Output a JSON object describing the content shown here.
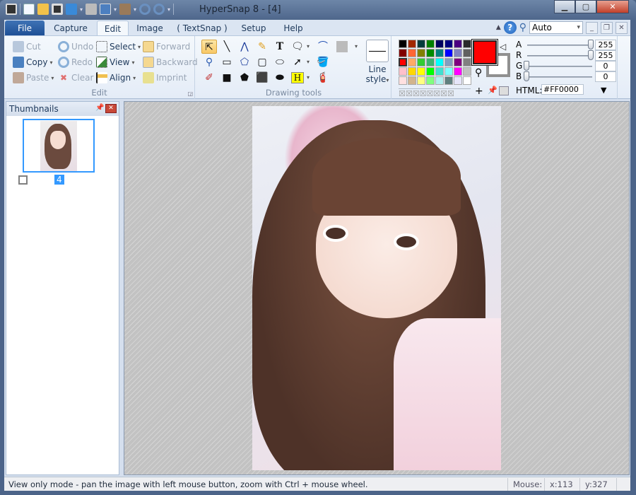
{
  "window": {
    "title": "HyperSnap 8 - [4]",
    "controls": [
      "minimize",
      "maximize",
      "close"
    ]
  },
  "quick_access": [
    "camera-icon",
    "new-icon",
    "open-icon",
    "save-icon",
    "upload-icon",
    "print-icon",
    "windows-icon",
    "clipboard-icon",
    "undo-icon",
    "redo-icon"
  ],
  "tabs": [
    {
      "label": "File"
    },
    {
      "label": "Capture"
    },
    {
      "label": "Edit",
      "active": true
    },
    {
      "label": "Image"
    },
    {
      "label": "( TextSnap )"
    },
    {
      "label": "Setup"
    },
    {
      "label": "Help"
    }
  ],
  "zoom": {
    "value": "Auto"
  },
  "edit_group": {
    "label": "Edit",
    "cut": "Cut",
    "copy": "Copy",
    "paste": "Paste",
    "undo": "Undo",
    "redo": "Redo",
    "clear": "Clear",
    "select": "Select",
    "view": "View",
    "align": "Align",
    "forward": "Forward",
    "backward": "Backward",
    "imprint": "Imprint"
  },
  "drawing_group": {
    "label": "Drawing tools",
    "line_style_1": "Line",
    "line_style_2": "style",
    "text_glyph": "T",
    "highlight_glyph": "H"
  },
  "palette": {
    "colors": [
      [
        "#000000",
        "#a02800",
        "#003c3c",
        "#008000",
        "#000060",
        "#000080",
        "#4b0082",
        "#2a2a2a"
      ],
      [
        "#800000",
        "#ff6633",
        "#808000",
        "#008c00",
        "#008080",
        "#0000ff",
        "#8080c0",
        "#606060"
      ],
      [
        "#ff0000",
        "#ffaa66",
        "#33cc33",
        "#3cb371",
        "#00ffff",
        "#80a0c0",
        "#800080",
        "#808080"
      ],
      [
        "#ffc0cb",
        "#ffd700",
        "#ffff00",
        "#00ff00",
        "#40e0d0",
        "#80ffff",
        "#ff00ff",
        "#c0c0c0"
      ],
      [
        "#ffe0e0",
        "#d2b48c",
        "#ffff80",
        "#80ff80",
        "#b0f0f0",
        "#608080",
        "#e6e6fa",
        "#ffffff"
      ]
    ],
    "foreground": "#FF0000",
    "background": "#FFFFFF"
  },
  "color_sliders": {
    "A": {
      "label": "A",
      "value": "255"
    },
    "R": {
      "label": "R",
      "value": "255"
    },
    "G": {
      "label": "G",
      "value": "0"
    },
    "B": {
      "label": "B",
      "value": "0"
    },
    "html_label": "HTML:",
    "html_value": "#FF0000"
  },
  "thumbnails": {
    "title": "Thumbnails",
    "items": [
      {
        "label": "4",
        "selected": true
      }
    ]
  },
  "status": {
    "message": "View only mode - pan the image with left mouse button, zoom with Ctrl + mouse wheel.",
    "mouse_label": "Mouse:",
    "x": "x:113",
    "y": "y:327"
  }
}
